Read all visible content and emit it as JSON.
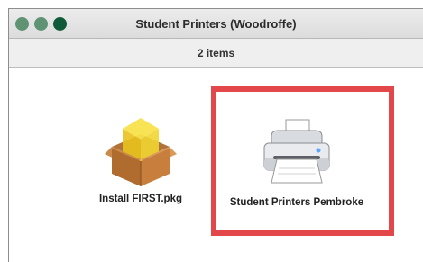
{
  "window": {
    "title": "Student Printers (Woodroffe)",
    "status": "2 items"
  },
  "items": [
    {
      "label": "Install FIRST.pkg",
      "icon": "package-icon"
    },
    {
      "label": "Student Printers Pembroke",
      "icon": "printer-icon"
    }
  ],
  "colors": {
    "highlight": "#e2484a",
    "window_dot_light": "#5f9374",
    "window_dot_dark": "#0f5a39"
  }
}
